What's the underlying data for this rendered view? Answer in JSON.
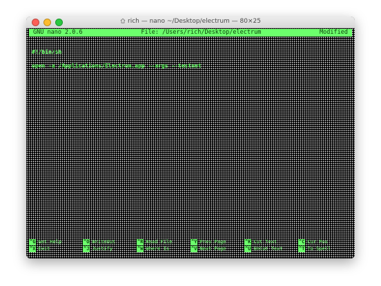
{
  "window": {
    "title": "rich — nano ~/Desktop/electrum — 80×25",
    "title_icon": "home-icon"
  },
  "status": {
    "version": "GNU nano 2.0.6",
    "file": "File: /Users/rich/Desktop/electrum",
    "state": "Modified"
  },
  "buffer": {
    "lines": [
      "#!/bin/sh",
      "",
      "open -a /Applications/Electrum.app --args --testnet"
    ]
  },
  "shortcuts": [
    {
      "key": "^G",
      "label": "Get Help"
    },
    {
      "key": "^O",
      "label": "WriteOut"
    },
    {
      "key": "^R",
      "label": "Read File"
    },
    {
      "key": "^Y",
      "label": "Prev Page"
    },
    {
      "key": "^K",
      "label": "Cut Text"
    },
    {
      "key": "^C",
      "label": "Cur Pos"
    },
    {
      "key": "^X",
      "label": "Exit"
    },
    {
      "key": "^J",
      "label": "Justify"
    },
    {
      "key": "^W",
      "label": "Where Is"
    },
    {
      "key": "^V",
      "label": "Next Page"
    },
    {
      "key": "^U",
      "label": "UnCut Text"
    },
    {
      "key": "^T",
      "label": "To Spell"
    }
  ],
  "colors": {
    "terminal_fg": "#6cff6c",
    "terminal_bg": "#000000"
  }
}
